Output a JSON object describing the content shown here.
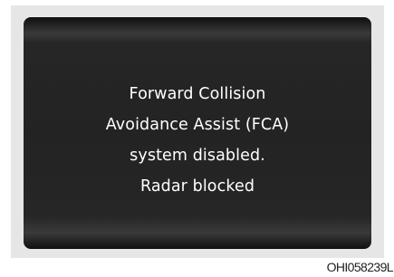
{
  "display": {
    "message_lines": [
      "Forward Collision",
      "Avoidance Assist (FCA)",
      "system disabled.",
      "Radar blocked"
    ]
  },
  "figure_code": "OHI058239L"
}
